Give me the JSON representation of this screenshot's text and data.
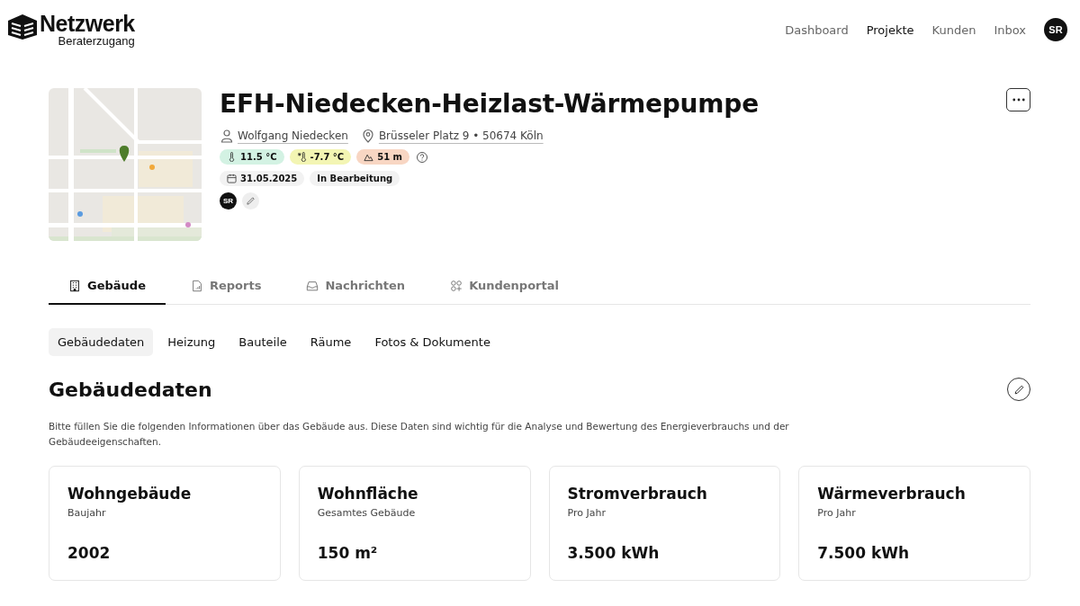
{
  "brand": {
    "name": "Netzwerk",
    "subtitle": "Beraterzugang"
  },
  "nav": [
    {
      "label": "Dashboard",
      "selected": false
    },
    {
      "label": "Projekte",
      "selected": true
    },
    {
      "label": "Kunden",
      "selected": false
    },
    {
      "label": "Inbox",
      "selected": false
    }
  ],
  "user_avatar": "SR",
  "project": {
    "title": "EFH-Niedecken-Heizlast-Wärmepumpe",
    "customer": "Wolfgang Niedecken",
    "address": "Brüsseler Platz 9 • 50674 Köln",
    "climate": [
      {
        "kind": "temperature",
        "value": "11.5 °C",
        "color": "#d3f2e3"
      },
      {
        "kind": "design-temperature",
        "value": "-7.7 °C",
        "color": "#f3f5b3"
      },
      {
        "kind": "altitude",
        "value": "51 m",
        "color": "#f8d6c3"
      }
    ],
    "date": "31.05.2025",
    "status": "In Bearbeitung",
    "assignee": "SR"
  },
  "tabs": [
    {
      "label": "Gebäude",
      "kind": "building",
      "selected": true
    },
    {
      "label": "Reports",
      "kind": "report",
      "selected": false
    },
    {
      "label": "Nachrichten",
      "kind": "inbox",
      "selected": false
    },
    {
      "label": "Kundenportal",
      "kind": "apps",
      "selected": false
    }
  ],
  "subtabs": [
    {
      "label": "Gebäudedaten",
      "selected": true
    },
    {
      "label": "Heizung",
      "selected": false
    },
    {
      "label": "Bauteile",
      "selected": false
    },
    {
      "label": "Räume",
      "selected": false
    },
    {
      "label": "Fotos & Dokumente",
      "selected": false
    }
  ],
  "section": {
    "title": "Gebäudedaten",
    "description": "Bitte füllen Sie die folgenden Informationen über das Gebäude aus. Diese Daten sind wichtig für die Analyse und Bewertung des Energieverbrauchs und der Gebäudeeigenschaften."
  },
  "cards": [
    {
      "title": "Wohngebäude",
      "subtitle": "Baujahr",
      "value": "2002"
    },
    {
      "title": "Wohnfläche",
      "subtitle": "Gesamtes Gebäude",
      "value": "150 m²"
    },
    {
      "title": "Stromverbrauch",
      "subtitle": "Pro Jahr",
      "value": "3.500 kWh"
    },
    {
      "title": "Wärmeverbrauch",
      "subtitle": "Pro Jahr",
      "value": "7.500 kWh"
    }
  ]
}
